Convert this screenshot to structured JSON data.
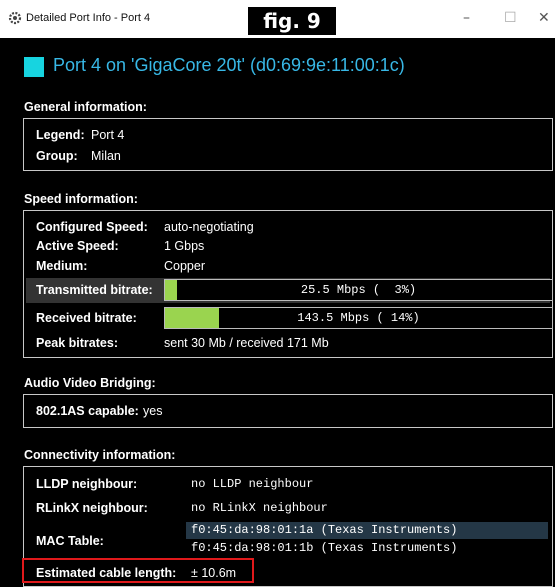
{
  "window": {
    "title": "Detailed Port Info - Port 4",
    "fig_label": "fig. 9",
    "minimize": "–",
    "maximize": "☐",
    "close": "✕"
  },
  "header": {
    "title": "Port 4 on 'GigaCore 20t' (d0:69:9e:11:00:1c)",
    "swatch_color": "#17d4e0"
  },
  "general": {
    "section_title": "General information:",
    "legend_label": "Legend:",
    "legend_value": "Port 4",
    "group_label": "Group:",
    "group_value": "Milan"
  },
  "speed": {
    "section_title": "Speed information:",
    "configured_label": "Configured Speed:",
    "configured_value": "auto-negotiating",
    "active_label": "Active Speed:",
    "active_value": "1 Gbps",
    "medium_label": "Medium:",
    "medium_value": "Copper",
    "tx_label": "Transmitted bitrate:",
    "tx_text": "25.5 Mbps (  3%)",
    "tx_percent": 3,
    "rx_label": "Received bitrate:",
    "rx_text": "143.5 Mbps ( 14%)",
    "rx_percent": 14,
    "peak_label": "Peak bitrates:",
    "peak_value": "sent 30 Mb / received 171 Mb"
  },
  "avb": {
    "section_title": "Audio Video Bridging:",
    "label": "802.1AS capable:",
    "value": "yes"
  },
  "connectivity": {
    "section_title": "Connectivity information:",
    "lldp_label": "LLDP neighbour:",
    "lldp_value": "no LLDP neighbour",
    "rlinkx_label": "RLinkX neighbour:",
    "rlinkx_value": "no RLinkX neighbour",
    "mac_label": "MAC Table:",
    "mac_entries": [
      "f0:45:da:98:01:1a (Texas Instruments)",
      "f0:45:da:98:01:1b (Texas Instruments)"
    ],
    "cable_label": "Estimated cable length:",
    "cable_value": "± 10.6m"
  },
  "colors": {
    "bar_fill": "#9ad44f",
    "title_blue": "#38b8e6",
    "highlight_red": "#e0191b"
  }
}
